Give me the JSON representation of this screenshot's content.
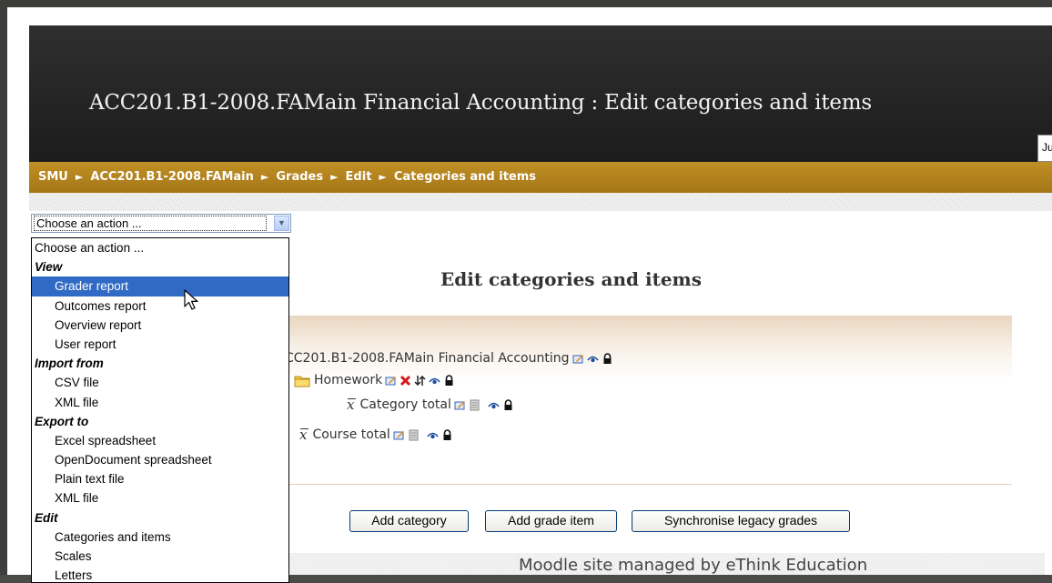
{
  "header": {
    "site_title": "ACC201.B1-2008.FAMain Financial Accounting : Edit categories and items",
    "lang_menu_text": "Ju"
  },
  "breadcrumb": {
    "items": [
      "SMU",
      "ACC201.B1-2008.FAMain",
      "Grades",
      "Edit",
      "Categories and items"
    ],
    "separator": "►"
  },
  "action_select": {
    "selected": "Choose an action ...",
    "options": [
      {
        "label": "Choose an action ...",
        "type": "option"
      },
      {
        "label": "View",
        "type": "group"
      },
      {
        "label": "Grader report",
        "type": "option",
        "highlighted": true
      },
      {
        "label": "Outcomes report",
        "type": "option"
      },
      {
        "label": "Overview report",
        "type": "option"
      },
      {
        "label": "User report",
        "type": "option"
      },
      {
        "label": "Import from",
        "type": "group"
      },
      {
        "label": "CSV file",
        "type": "option"
      },
      {
        "label": "XML file",
        "type": "option"
      },
      {
        "label": "Export to",
        "type": "group"
      },
      {
        "label": "Excel spreadsheet",
        "type": "option"
      },
      {
        "label": "OpenDocument spreadsheet",
        "type": "option"
      },
      {
        "label": "Plain text file",
        "type": "option"
      },
      {
        "label": "XML file",
        "type": "option"
      },
      {
        "label": "Edit",
        "type": "group"
      },
      {
        "label": "Categories and items",
        "type": "option"
      },
      {
        "label": "Scales",
        "type": "option"
      },
      {
        "label": "Letters",
        "type": "option"
      }
    ]
  },
  "main": {
    "heading": "Edit categories and items",
    "tree": {
      "course": "CC201.B1-2008.FAMain Financial Accounting",
      "category": "Homework",
      "category_total": "Category total",
      "course_total": "Course total"
    }
  },
  "buttons": {
    "add_category": "Add category",
    "add_grade_item": "Add grade item",
    "sync_legacy": "Synchronise legacy grades"
  },
  "footer": {
    "text": "Moodle site managed by eThink Education"
  },
  "colors": {
    "navbar": "#b08321",
    "header_bg": "#262626",
    "selection": "#316ac5"
  }
}
